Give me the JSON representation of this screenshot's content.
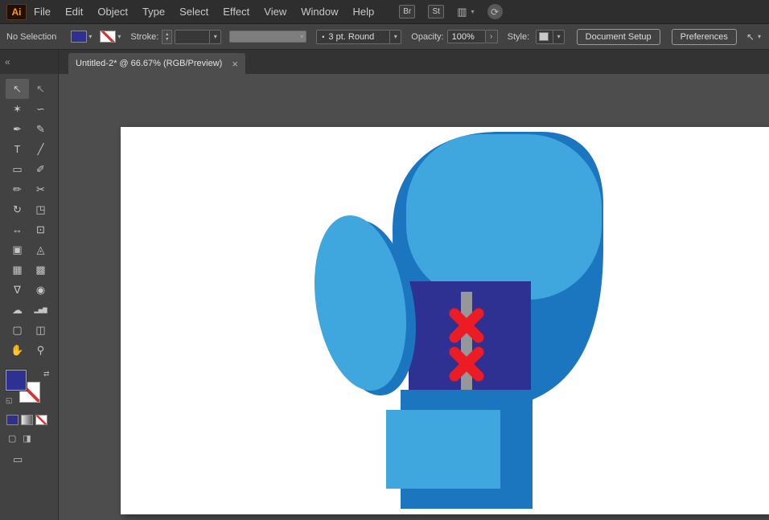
{
  "menubar": {
    "logo": "Ai",
    "items": [
      "File",
      "Edit",
      "Object",
      "Type",
      "Select",
      "Effect",
      "View",
      "Window",
      "Help"
    ],
    "bridge_button": "Br",
    "stock_button": "St"
  },
  "glyphs": {
    "chevron_down": "▾",
    "spinner_up": "▴",
    "spinner_down": "▾",
    "flyout": "›",
    "swap": "⇄",
    "default_swatches": "◱",
    "workspace": "▥",
    "sync": "⟳",
    "tool_options_arrow": "↖",
    "draw_mode_a": "▢",
    "draw_mode_b": "◨",
    "screen_mode": "▭",
    "close": "×",
    "collapse": "«",
    "bullet": "•"
  },
  "control_bar": {
    "selection_status": "No Selection",
    "stroke_label": "Stroke:",
    "brush_value": "3 pt. Round",
    "opacity_label": "Opacity:",
    "opacity_value": "100%",
    "style_label": "Style:",
    "document_setup_button": "Document Setup",
    "preferences_button": "Preferences",
    "fill_color": "#2e3192",
    "stroke_color": "none"
  },
  "document": {
    "tab_title": "Untitled-2* @ 66.67% (RGB/Preview)",
    "zoom_percent": "66.67%",
    "color_mode": "RGB/Preview"
  },
  "toolbar": {
    "active_tool": "selection-tool",
    "fill_color": "#2e3192",
    "tools": [
      {
        "name": "selection-tool",
        "glyph": "↖"
      },
      {
        "name": "direct-selection-tool",
        "glyph": "↖"
      },
      {
        "name": "magic-wand-tool",
        "glyph": "✶"
      },
      {
        "name": "lasso-tool",
        "glyph": "∽"
      },
      {
        "name": "pen-tool",
        "glyph": "✒"
      },
      {
        "name": "curvature-tool",
        "glyph": "✎"
      },
      {
        "name": "type-tool",
        "glyph": "T"
      },
      {
        "name": "line-segment-tool",
        "glyph": "╱"
      },
      {
        "name": "rectangle-tool",
        "glyph": "▭"
      },
      {
        "name": "paintbrush-tool",
        "glyph": "✐"
      },
      {
        "name": "pencil-tool",
        "glyph": "✏"
      },
      {
        "name": "scissors-tool",
        "glyph": "✂"
      },
      {
        "name": "rotate-tool",
        "glyph": "↻"
      },
      {
        "name": "scale-tool",
        "glyph": "◳"
      },
      {
        "name": "width-tool",
        "glyph": "↔"
      },
      {
        "name": "free-transform-tool",
        "glyph": "⊡"
      },
      {
        "name": "shape-builder-tool",
        "glyph": "▣"
      },
      {
        "name": "perspective-grid-tool",
        "glyph": "◬"
      },
      {
        "name": "mesh-tool",
        "glyph": "▦"
      },
      {
        "name": "gradient-tool",
        "glyph": "▩"
      },
      {
        "name": "eyedropper-tool",
        "glyph": "∇"
      },
      {
        "name": "blend-tool",
        "glyph": "◉"
      },
      {
        "name": "symbol-sprayer-tool",
        "glyph": "☁"
      },
      {
        "name": "column-graph-tool",
        "glyph": "▂▅▇"
      },
      {
        "name": "artboard-tool",
        "glyph": "▢"
      },
      {
        "name": "slice-tool",
        "glyph": "◫"
      },
      {
        "name": "hand-tool",
        "glyph": "✋"
      },
      {
        "name": "zoom-tool",
        "glyph": "⚲"
      }
    ]
  },
  "artwork": {
    "description": "boxing glove illustration on white artboard",
    "colors": {
      "artboard": "#ffffff",
      "body": "#1b76bf",
      "highlight": "#3fa7dd",
      "wrist": "#2e3192",
      "lace": "#95979a",
      "stitch": "#ed1c24"
    }
  }
}
